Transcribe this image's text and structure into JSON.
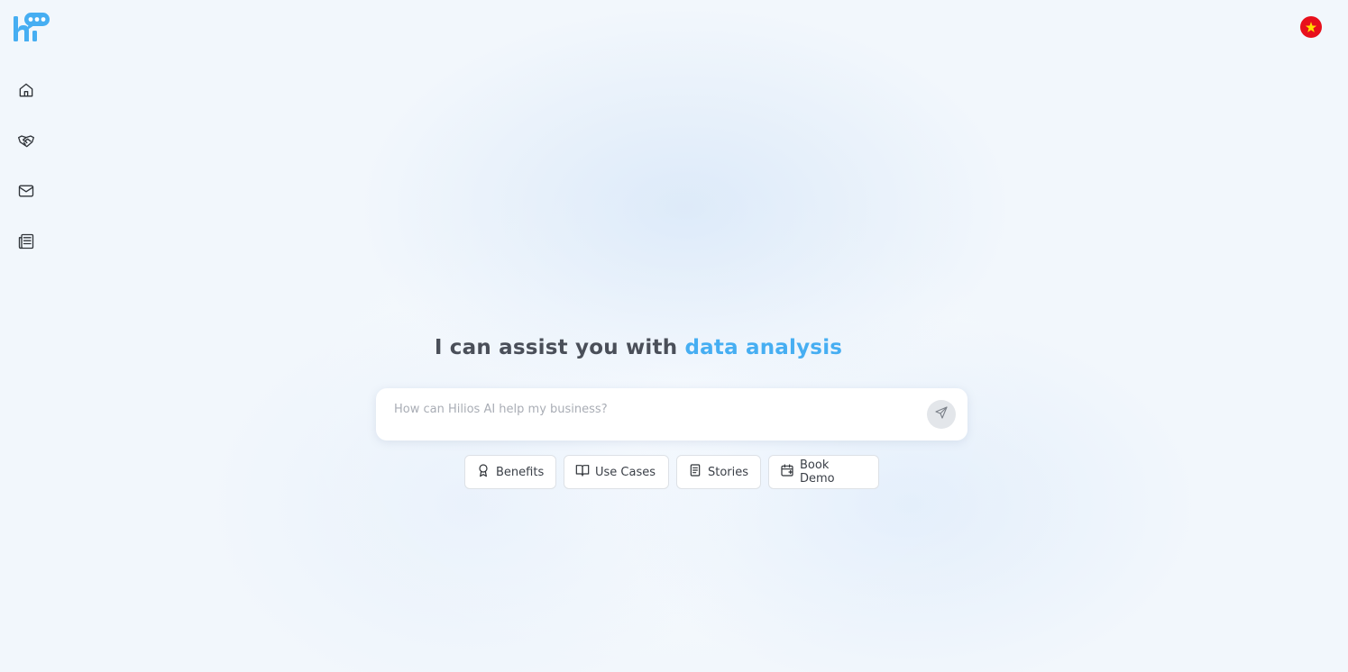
{
  "logo": {
    "text": "hi",
    "icon": "hilios-logo-icon",
    "color": "#46aef2"
  },
  "language": {
    "icon": "vietnam-flag-icon",
    "color": "#e8101c"
  },
  "sidebar": {
    "items": [
      {
        "icon": "home-icon"
      },
      {
        "icon": "handshake-icon"
      },
      {
        "icon": "mail-icon"
      },
      {
        "icon": "newspaper-icon"
      }
    ]
  },
  "hero": {
    "prefix": "I can assist you with",
    "highlight": "data analysis",
    "highlight_color": "#46aef2"
  },
  "search": {
    "placeholder": "How can Hilios AI help my business?",
    "value": "",
    "send_icon": "send-icon"
  },
  "chips": [
    {
      "label": "Benefits",
      "icon": "award-icon"
    },
    {
      "label": "Use Cases",
      "icon": "book-open-icon"
    },
    {
      "label": "Stories",
      "icon": "document-icon"
    },
    {
      "label": "Book Demo",
      "icon": "calendar-plus-icon"
    }
  ]
}
